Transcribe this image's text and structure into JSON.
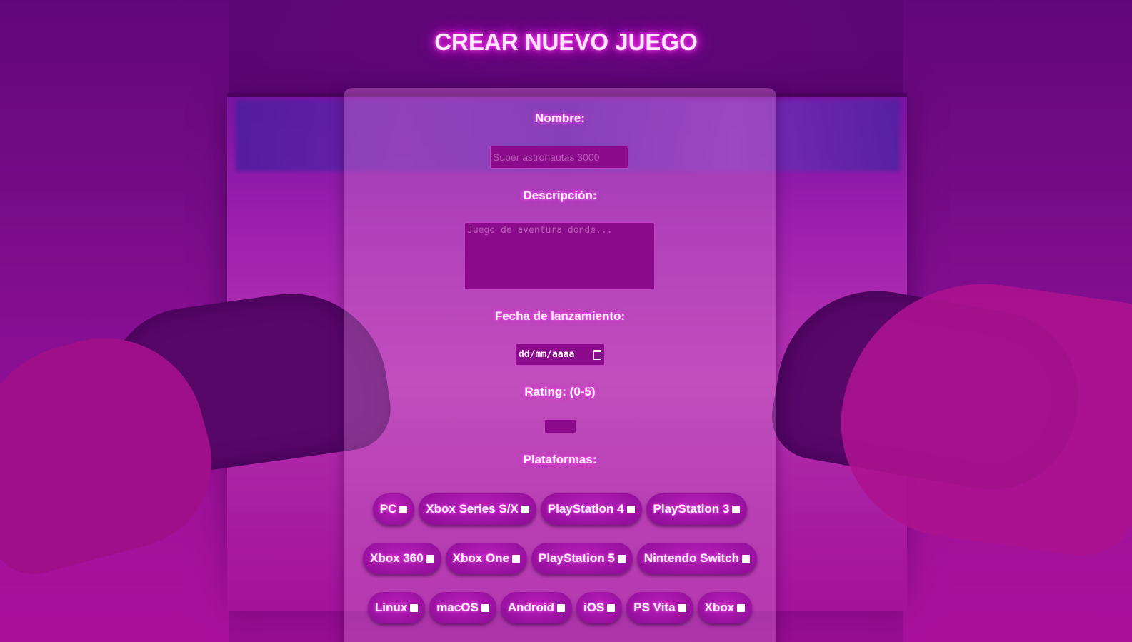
{
  "page": {
    "title": "CREAR NUEVO JUEGO"
  },
  "form": {
    "name_label": "Nombre:",
    "name_placeholder": "Super astronautas 3000",
    "name_value": "",
    "description_label": "Descripción:",
    "description_placeholder": "Juego de aventura donde...",
    "description_value": "",
    "release_date_label": "Fecha de lanzamiento:",
    "release_date_placeholder": "dd/mm/aaaa",
    "rating_label": "Rating: (0-5)",
    "rating_value": "",
    "platforms_label": "Plataformas:",
    "platforms": [
      [
        {
          "label": "PC",
          "checked": false
        },
        {
          "label": "Xbox Series S/X",
          "checked": false
        },
        {
          "label": "PlayStation 4",
          "checked": false
        },
        {
          "label": "PlayStation 3",
          "checked": false
        }
      ],
      [
        {
          "label": "Xbox 360",
          "checked": false
        },
        {
          "label": "Xbox One",
          "checked": false
        },
        {
          "label": "PlayStation 5",
          "checked": false
        },
        {
          "label": "Nintendo Switch",
          "checked": false
        }
      ],
      [
        {
          "label": "Linux",
          "checked": false
        },
        {
          "label": "macOS",
          "checked": false
        },
        {
          "label": "Android",
          "checked": false
        },
        {
          "label": "iOS",
          "checked": false
        },
        {
          "label": "PS Vita",
          "checked": false
        },
        {
          "label": "Xbox",
          "checked": false
        }
      ]
    ]
  },
  "colors": {
    "accent": "#8c0b8c",
    "glow": "#ff44ff",
    "text": "#fff4ff"
  },
  "icons": {
    "date_picker": "calendar-icon"
  }
}
